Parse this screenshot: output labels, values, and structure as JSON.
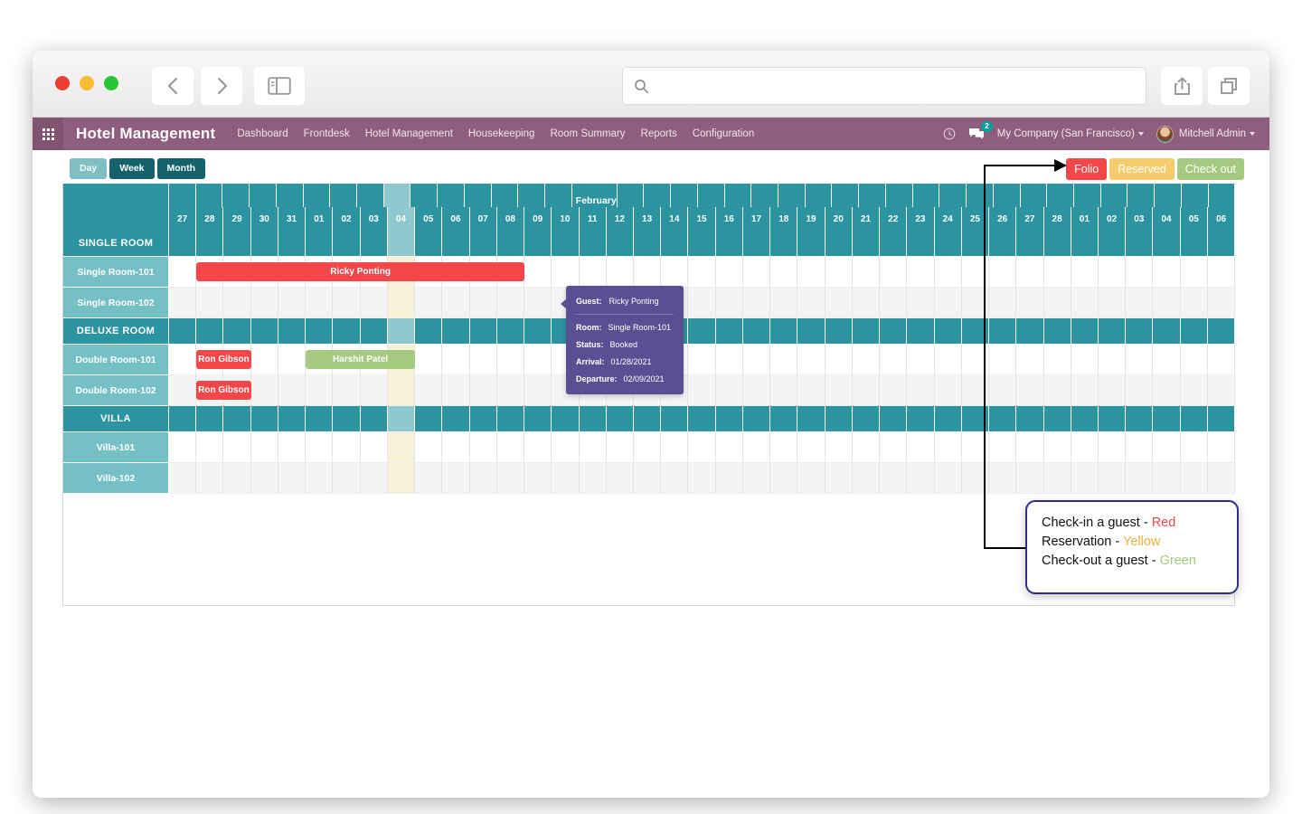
{
  "browser": {
    "address_value": "",
    "address_placeholder": "",
    "icons": {
      "back": "chevron-left-icon",
      "forward": "chevron-right-icon",
      "sidebar": "sidebar-toggle-icon",
      "search": "search-icon",
      "share": "share-icon",
      "tabs": "tabs-icon"
    }
  },
  "navbar": {
    "brand": "Hotel Management",
    "menu": [
      {
        "label": "Dashboard"
      },
      {
        "label": "Frontdesk"
      },
      {
        "label": "Hotel Management"
      },
      {
        "label": "Housekeeping"
      },
      {
        "label": "Room Summary"
      },
      {
        "label": "Reports"
      },
      {
        "label": "Configuration"
      }
    ],
    "systray": {
      "clock_icon": "clock-icon",
      "messages_icon": "chat-bubble-icon",
      "messages_count": "2",
      "company": "My Company (San Francisco)",
      "user": "Mitchell Admin"
    }
  },
  "toolbar": {
    "scales": [
      {
        "label": "Day",
        "active": true
      },
      {
        "label": "Week",
        "active": false
      },
      {
        "label": "Month",
        "active": false
      }
    ],
    "legend": [
      {
        "label": "Folio",
        "color": "#f3474a"
      },
      {
        "label": "Reserved",
        "color": "#f5cb6b"
      },
      {
        "label": "Check out",
        "color": "#a5c97f"
      }
    ]
  },
  "gantt": {
    "month_label": "February",
    "month_label_col": 15,
    "today_col": 8,
    "days": [
      "27",
      "28",
      "29",
      "30",
      "31",
      "01",
      "02",
      "03",
      "04",
      "05",
      "06",
      "07",
      "08",
      "09",
      "10",
      "11",
      "12",
      "13",
      "14",
      "15",
      "16",
      "17",
      "18",
      "19",
      "20",
      "21",
      "22",
      "23",
      "24",
      "25",
      "26",
      "27",
      "28",
      "01",
      "02",
      "03",
      "04",
      "05",
      "06"
    ],
    "rows": [
      {
        "type": "group",
        "label": "SINGLE ROOM"
      },
      {
        "type": "room",
        "label": "Single Room-101",
        "stripe": "odd",
        "bars": [
          {
            "guest": "Ricky Ponting",
            "color": "red",
            "start": 1,
            "span": 12
          }
        ]
      },
      {
        "type": "room",
        "label": "Single Room-102",
        "stripe": "even",
        "bars": []
      },
      {
        "type": "group",
        "label": "DELUXE ROOM"
      },
      {
        "type": "room",
        "label": "Double Room-101",
        "stripe": "odd",
        "bars": [
          {
            "guest": "Ron Gibson",
            "color": "red",
            "start": 1,
            "span": 2
          },
          {
            "guest": "Harshit Patel",
            "color": "green",
            "start": 5,
            "span": 4
          }
        ]
      },
      {
        "type": "room",
        "label": "Double Room-102",
        "stripe": "even",
        "bars": [
          {
            "guest": "Ron Gibson",
            "color": "red",
            "start": 1,
            "span": 2
          }
        ]
      },
      {
        "type": "group",
        "label": "VILLA"
      },
      {
        "type": "room",
        "label": "Villa-101",
        "stripe": "odd",
        "bars": []
      },
      {
        "type": "room",
        "label": "Villa-102",
        "stripe": "even",
        "bars": []
      }
    ]
  },
  "tooltip": {
    "guest_key": "Guest:",
    "guest_value": "Ricky Ponting",
    "rows": [
      {
        "key": "Room:",
        "value": "Single Room-101"
      },
      {
        "key": "Status:",
        "value": "Booked"
      },
      {
        "key": "Arrival:",
        "value": "01/28/2021"
      },
      {
        "key": "Departure:",
        "value": "02/09/2021"
      }
    ]
  },
  "annotation": {
    "lines": [
      {
        "text": "Check-in a guest - ",
        "keyword": "Red",
        "color": "#f3474a"
      },
      {
        "text": "Reservation - ",
        "keyword": "Yellow",
        "color": "#e8b33d"
      },
      {
        "text": "Check-out a guest - ",
        "keyword": "Green",
        "color": "#a5c97f"
      }
    ]
  }
}
